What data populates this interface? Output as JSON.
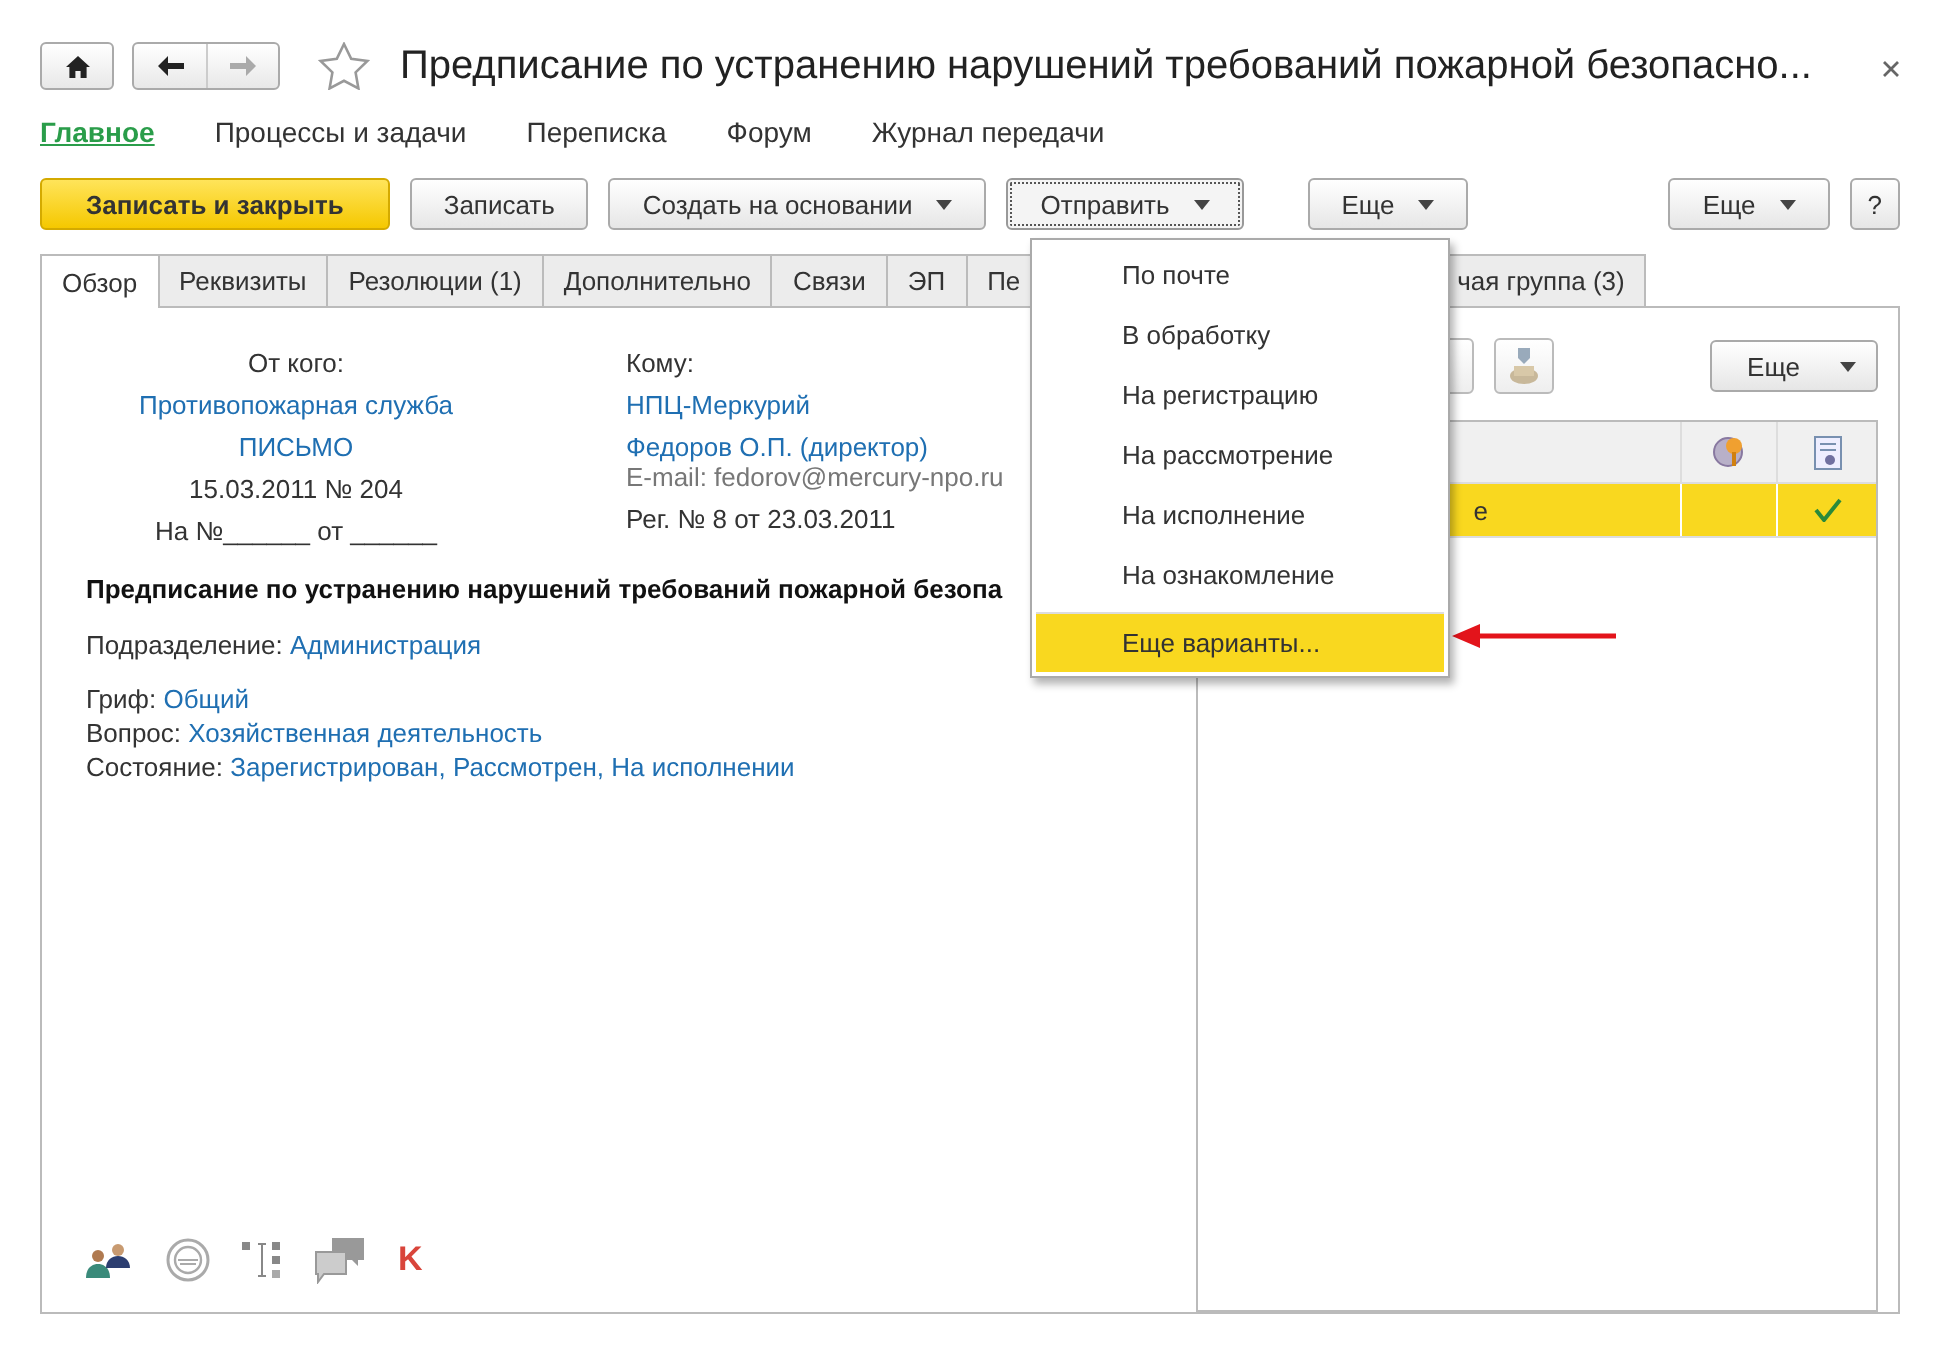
{
  "window": {
    "title": "Предписание по устранению нарушений требований пожарной безопасно..."
  },
  "nav": [
    {
      "label": "Главное",
      "selected": true
    },
    {
      "label": "Процессы и задачи",
      "selected": false
    },
    {
      "label": "Переписка",
      "selected": false
    },
    {
      "label": "Форум",
      "selected": false
    },
    {
      "label": "Журнал передачи",
      "selected": false
    }
  ],
  "toolbar": [
    {
      "label": "Записать и закрыть",
      "kind": "primary"
    },
    {
      "label": "Записать",
      "kind": "plain"
    },
    {
      "label": "Создать на основании",
      "kind": "dropdown",
      "expanded": false
    },
    {
      "label": "Отправить",
      "kind": "dropdown",
      "expanded": true
    },
    {
      "label": "Еще",
      "kind": "dropdown",
      "expanded": false
    }
  ],
  "toolbar_right": [
    {
      "label": "Еще",
      "kind": "dropdown",
      "expanded": false
    },
    {
      "label": "?",
      "kind": "plain"
    }
  ],
  "tabs": [
    {
      "label": "Обзор",
      "selected": true
    },
    {
      "label": "Реквизиты",
      "selected": false
    },
    {
      "label": "Резолюции (1)",
      "selected": false
    },
    {
      "label": "Дополнительно",
      "selected": false
    },
    {
      "label": "Связи",
      "selected": false
    },
    {
      "label": "ЭП",
      "selected": false
    },
    {
      "label": "Пе",
      "selected": false
    },
    {
      "label": "чая группа (3)",
      "selected": false
    }
  ],
  "letter": {
    "from_label": "От кого:",
    "from_org": "Противопожарная служба",
    "doc_type": "ПИСЬМО",
    "doc_date": "15.03.2011 № 204",
    "reply_ref": "На №______ от ______",
    "to_label": "Кому:",
    "to_org": "НПЦ-Меркурий",
    "to_person": "Федоров О.П. (директор)",
    "to_email": "E-mail: fedorov@mercury-npo.ru",
    "reg": "Рег. № 8 от 23.03.2011",
    "subject": "Предписание по устранению нарушений требований пожарной безопа",
    "fields": [
      {
        "label": "Подразделение:",
        "value": "Администрация"
      },
      {
        "label": "Гриф:",
        "value": "Общий"
      },
      {
        "label": "Вопрос:",
        "value": "Хозяйственная деятельность"
      },
      {
        "label": "Состояние:",
        "value": "Зарегистрирован, Рассмотрен, На исполнении"
      }
    ]
  },
  "menu": {
    "items": [
      {
        "label": "По почте",
        "selected": false
      },
      {
        "label": "В обработку",
        "selected": false
      },
      {
        "label": "На регистрацию",
        "selected": false
      },
      {
        "label": "На рассмотрение",
        "selected": false
      },
      {
        "label": "На исполнение",
        "selected": false
      },
      {
        "label": "На ознакомление",
        "selected": false
      },
      {
        "label": "Еще варианты...",
        "selected": true
      }
    ]
  },
  "panel": {
    "more_button": "Еще",
    "rows": [
      {
        "text": "е",
        "selected": true,
        "checked": true
      }
    ]
  },
  "bottom_mark": "K"
}
